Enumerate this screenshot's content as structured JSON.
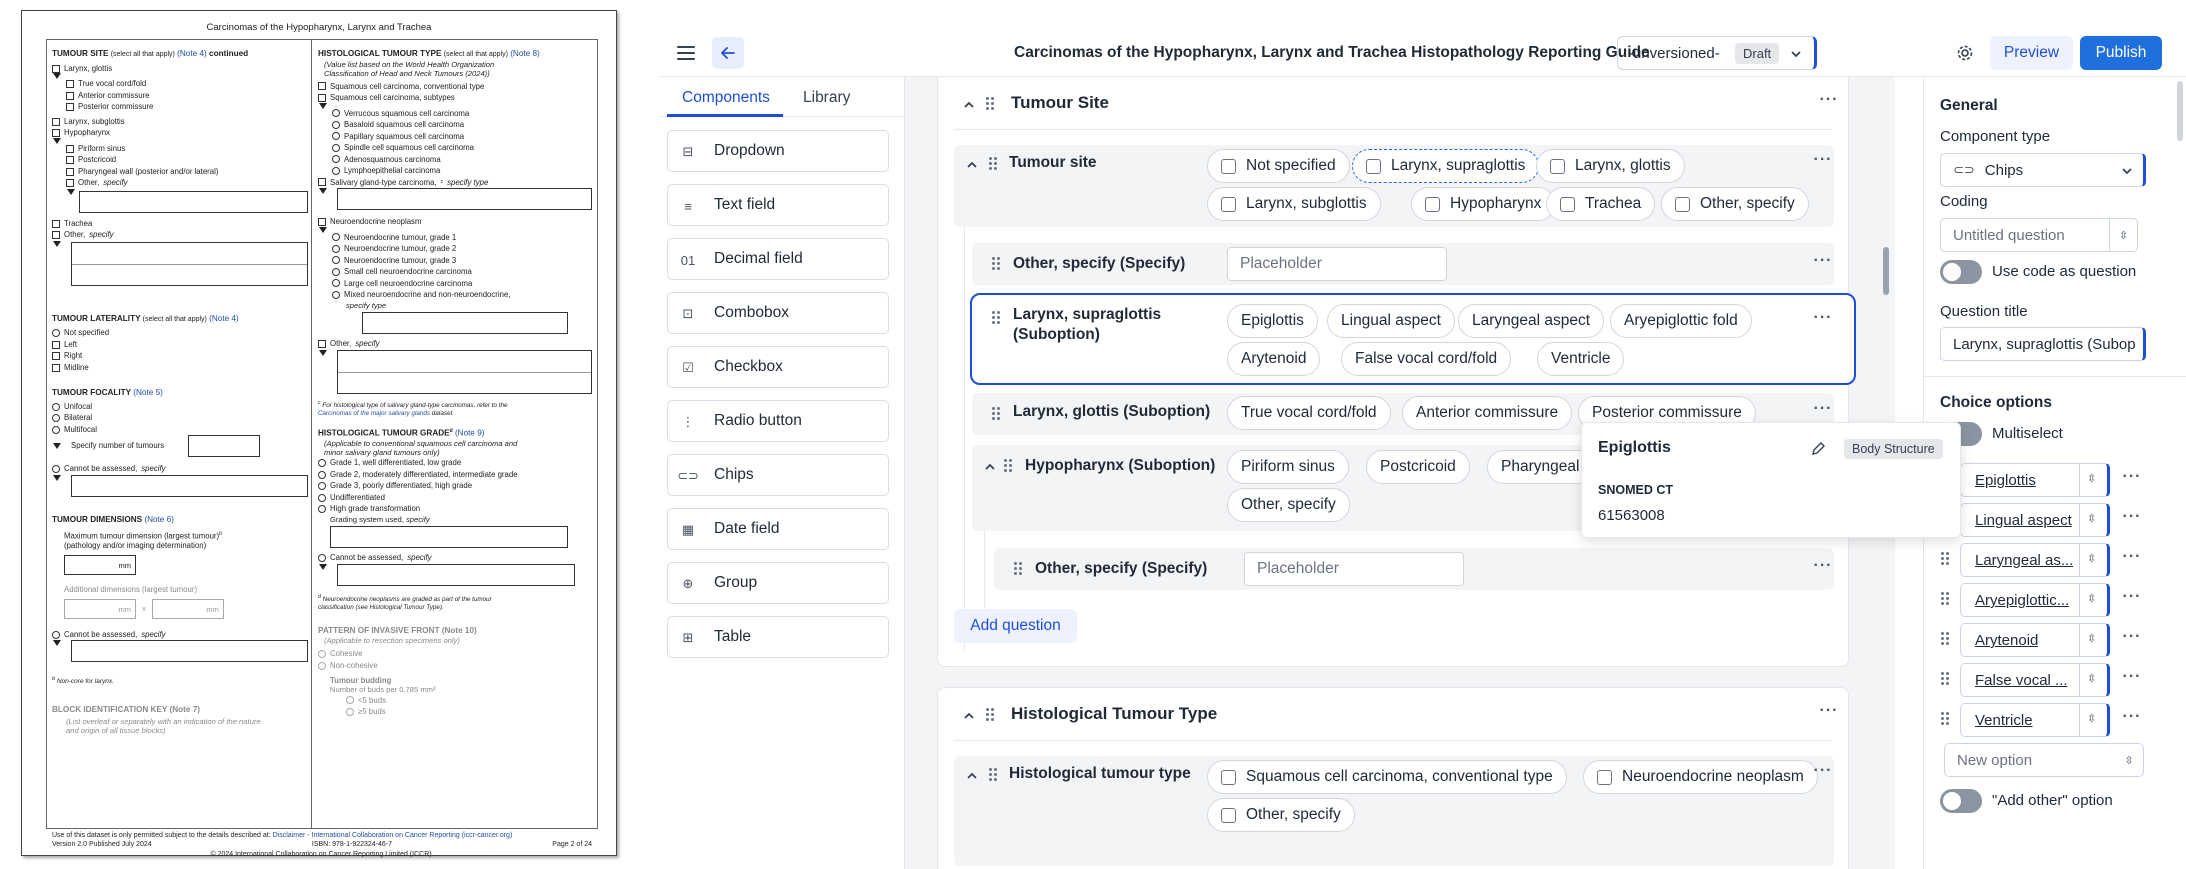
{
  "document": {
    "title": "Carcinomas of the Hypopharynx, Larynx and Trachea",
    "tumour_site": {
      "heading": "TUMOUR SITE",
      "hint": "(select all that apply)",
      "note": "(Note 4)",
      "cont": "continued",
      "larynx_glottis": "Larynx, glottis",
      "glottis_sub": [
        "True vocal cord/fold",
        "Anterior commissure",
        "Posterior commissure"
      ],
      "larynx_subglottis": "Larynx, subglottis",
      "hypopharynx": "Hypopharynx",
      "hypo_sub": [
        "Piriform sinus",
        "Postcricoid",
        "Pharyngeal wall (posterior and/or lateral)"
      ],
      "other_prefix": "Other, ",
      "specify": "specify",
      "trachea": "Trachea"
    },
    "laterality": {
      "heading": "TUMOUR LATERALITY",
      "hint": "(select all that apply)",
      "note": "(Note 4)",
      "options": [
        "Not specified",
        "Left",
        "Right",
        "Midline"
      ]
    },
    "focality": {
      "heading": "TUMOUR FOCALITY",
      "note": "(Note 5)",
      "options": [
        "Unifocal",
        "Bilateral",
        "Multifocal"
      ],
      "num": "Specify number of tumours",
      "cba": "Cannot be assessed, "
    },
    "dimensions": {
      "heading": "TUMOUR DIMENSIONS",
      "note": "(Note 6)",
      "max1": "Maximum tumour dimension (largest tumour)",
      "sup": "b",
      "max2": "(pathology and/or imaging determination)",
      "mm": "mm",
      "additional": "Additional dimensions (largest tumour)",
      "x": "x"
    },
    "footnote_b": "Non-core for larynx.",
    "block_key": {
      "heading": "BLOCK IDENTIFICATION KEY",
      "note": "(Note 7)",
      "desc1": "(List overleaf or separately with an indication of the nature",
      "desc2": "and origin of all tissue blocks)"
    },
    "hist_type": {
      "heading": "HISTOLOGICAL TUMOUR TYPE",
      "hint": "(select all that apply)",
      "note": "(Note 8)",
      "desc1": "(Value list based on the World Health Organization",
      "desc2": "Classification of Head and Neck Tumours (2024))",
      "scc_conv": "Squamous cell carcinoma, conventional type",
      "scc_sub": "Squamous cell carcinoma, subtypes",
      "scc_list": [
        "Verrucous squamous cell carcinoma",
        "Basaloid squamous cell carcinoma",
        "Papillary squamous cell carcinoma",
        "Spindle cell squamous cell carcinoma",
        "Adenosquamous carcinoma",
        "Lymphoepithelial carcinoma"
      ],
      "salivary": "Salivary gland-type carcinoma,",
      "salivary_sup": "c",
      "specify_type": "specify type",
      "neuro": "Neuroendocrine neoplasm",
      "neuro_list": [
        "Neuroendocrine tumour, grade 1",
        "Neuroendocrine tumour, grade 2",
        "Neuroendocrine tumour, grade 3",
        "Small cell neuroendocrine carcinoma",
        "Large cell neuroendocrine carcinoma",
        "Mixed neuroendocrine and non-neuroendocrine,"
      ],
      "mixed_specify": "specify type",
      "other": "Other, ",
      "specify": "specify"
    },
    "footnote_c1": "For histological type of salivary gland-type carcinomas, refer to the",
    "footnote_c2": "Carcinomas of the major salivary glands",
    "footnote_c3": "dataset.",
    "grade": {
      "heading": "HISTOLOGICAL TUMOUR GRADE",
      "sup": "d",
      "note": "(Note 9)",
      "desc1": "(Applicable to conventional squamous cell carcinoma and",
      "desc2": "minor salivary gland tumours only)",
      "options": [
        "Grade 1, well differentiated, low grade",
        "Grade 2, moderately differentiated, intermediate grade",
        "Grade 3, poorly differentiated, high grade",
        "Undifferentiated",
        "High grade transformation"
      ],
      "system": "Grading system used, ",
      "specify": "specify",
      "cba": "Cannot be assessed, "
    },
    "footnote_d1": "Neuroendocrine neoplasms are graded as part of the tumour",
    "footnote_d2": "classification (see Histological Tumour Type).",
    "invasive": {
      "heading": "PATTERN OF INVASIVE FRONT",
      "note": "(Note 10)",
      "desc": "(Applicable to resection specimens only)",
      "options": [
        "Cohesive",
        "Non-cohesive"
      ],
      "budding": "Tumour budding",
      "buds": "Number of buds per 0.785 mm²",
      "bud_opts": [
        "<5 buds",
        "≥5 buds"
      ]
    },
    "footer": {
      "line1a": "Use of this dataset is only permitted subject to the details described at: ",
      "line1b": "Disclaimer - International Collaboration on Cancer Reporting (iccr-cancer.org)",
      "version": "Version 2.0 Published July 2024",
      "isbn": "ISBN: 978-1-922324-46-7",
      "page": "Page 2 of 24",
      "copyright": "© 2024 International Collaboration on Cancer Reporting Limited (ICCR)."
    }
  },
  "app": {
    "title": "Carcinomas of the Hypopharynx, Larynx and Trachea Histopathology Reporting Guide",
    "version": "-unversioned-",
    "status": "Draft",
    "preview": "Preview",
    "publish": "Publish",
    "tabs": [
      "Components",
      "Library"
    ],
    "components": [
      {
        "label": "Dropdown",
        "icon": "dropdown-icon",
        "glyph": "⊟"
      },
      {
        "label": "Text field",
        "icon": "text-field-icon",
        "glyph": "≡"
      },
      {
        "label": "Decimal field",
        "icon": "decimal-icon",
        "glyph": "01"
      },
      {
        "label": "Combobox",
        "icon": "combobox-icon",
        "glyph": "⊡"
      },
      {
        "label": "Checkbox",
        "icon": "checkbox-icon",
        "glyph": "☑"
      },
      {
        "label": "Radio button",
        "icon": "radio-icon",
        "glyph": "⋮"
      },
      {
        "label": "Chips",
        "icon": "chips-icon",
        "glyph": "⊂⊃"
      },
      {
        "label": "Date field",
        "icon": "date-icon",
        "glyph": "▦"
      },
      {
        "label": "Group",
        "icon": "group-icon",
        "glyph": "⊕"
      },
      {
        "label": "Table",
        "icon": "table-icon",
        "glyph": "⊞"
      }
    ],
    "section1": {
      "title": "Tumour Site",
      "q_site": "Tumour site",
      "site_chips": [
        "Not specified",
        "Larynx, supraglottis",
        "Larynx, glottis",
        "Larynx, subglottis",
        "Hypopharynx",
        "Trachea",
        "Other, specify"
      ],
      "q_other": "Other, specify (Specify)",
      "placeholder": "Placeholder",
      "q_supra_1": "Larynx, supraglottis",
      "q_supra_2": "(Suboption)",
      "supra_chips": [
        "Epiglottis",
        "Lingual aspect",
        "Laryngeal aspect",
        "Aryepiglottic fold",
        "Arytenoid",
        "False vocal cord/fold",
        "Ventricle"
      ],
      "q_glottis": "Larynx, glottis (Suboption)",
      "glottis_chips": [
        "True vocal cord/fold",
        "Anterior commissure",
        "Posterior commissure"
      ],
      "q_hypo": "Hypopharynx (Suboption)",
      "hypo_chips": [
        "Piriform sinus",
        "Postcricoid",
        "Pharyngeal wall",
        "Other, specify"
      ],
      "q_hypo_other": "Other, specify (Specify)",
      "add_question": "Add question"
    },
    "section2": {
      "title": "Histological Tumour Type",
      "q": "Histological tumour type",
      "chips": [
        "Squamous cell carcinoma, conventional type",
        "Neuroendocrine neoplasm",
        "Other, specify"
      ]
    },
    "popover": {
      "title": "Epiglottis",
      "badge": "Body Structure",
      "system": "SNOMED CT",
      "code": "61563008"
    },
    "props": {
      "general": "General",
      "component_type_label": "Component type",
      "component_type": "Chips",
      "coding_label": "Coding",
      "coding_value": "Untitled question",
      "use_code": "Use code as question",
      "question_title_label": "Question title",
      "question_title": "Larynx, supraglottis (Subop",
      "choice_options": "Choice options",
      "multiselect": "Multiselect",
      "options": [
        "Epiglottis",
        "Lingual aspect",
        "Laryngeal as...",
        "Aryepiglottic...",
        "Arytenoid",
        "False vocal ...",
        "Ventricle"
      ],
      "new_option": "New option",
      "add_other": "\"Add other\" option"
    },
    "colors": {
      "accent": "#1d4ed8",
      "publish_bg": "#1f6fdc",
      "preview_bg": "#eef2ff"
    }
  }
}
